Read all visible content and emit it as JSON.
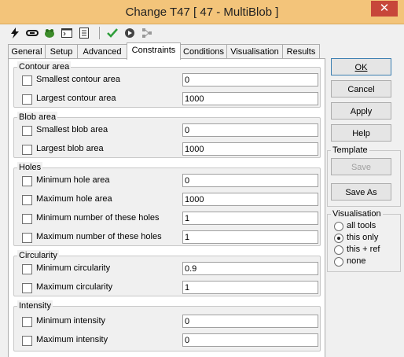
{
  "window": {
    "title": "Change T47 [ 47 - MultiBlob ]",
    "close_glyph": "✕"
  },
  "toolbar": {
    "icons": [
      "lightning-icon",
      "link-icon",
      "frog-icon",
      "console-icon",
      "list-icon",
      "check-icon",
      "run-icon",
      "network-icon"
    ]
  },
  "tabs": [
    "General",
    "Setup",
    "Advanced",
    "Constraints",
    "Conditions",
    "Visualisation",
    "Results"
  ],
  "active_tab": "Constraints",
  "groups": {
    "contour": {
      "title": "Contour area",
      "rows": [
        {
          "label": "Smallest contour area",
          "value": "0"
        },
        {
          "label": "Largest contour area",
          "value": "1000"
        }
      ]
    },
    "blob": {
      "title": "Blob area",
      "rows": [
        {
          "label": "Smallest blob area",
          "value": "0"
        },
        {
          "label": "Largest blob area",
          "value": "1000"
        }
      ]
    },
    "holes": {
      "title": "Holes",
      "rows": [
        {
          "label": "Minimum hole area",
          "value": "0"
        },
        {
          "label": "Maximum hole area",
          "value": "1000"
        },
        {
          "label": "Minimum number of these holes",
          "value": "1"
        },
        {
          "label": "Maximum number of these holes",
          "value": "1"
        }
      ]
    },
    "circularity": {
      "title": "Circularity",
      "rows": [
        {
          "label": "Minimum circularity",
          "value": "0.9"
        },
        {
          "label": "Maximum circularity",
          "value": "1"
        }
      ]
    },
    "intensity": {
      "title": "Intensity",
      "rows": [
        {
          "label": "Minimum intensity",
          "value": "0"
        },
        {
          "label": "Maximum intensity",
          "value": "0"
        }
      ]
    }
  },
  "buttons": {
    "ok": "OK",
    "cancel": "Cancel",
    "apply": "Apply",
    "help": "Help"
  },
  "template": {
    "title": "Template",
    "save": "Save",
    "save_as": "Save As"
  },
  "visualisation": {
    "title": "Visualisation",
    "options": [
      "all tools",
      "this only",
      "this + ref",
      "none"
    ],
    "selected": "this only"
  }
}
